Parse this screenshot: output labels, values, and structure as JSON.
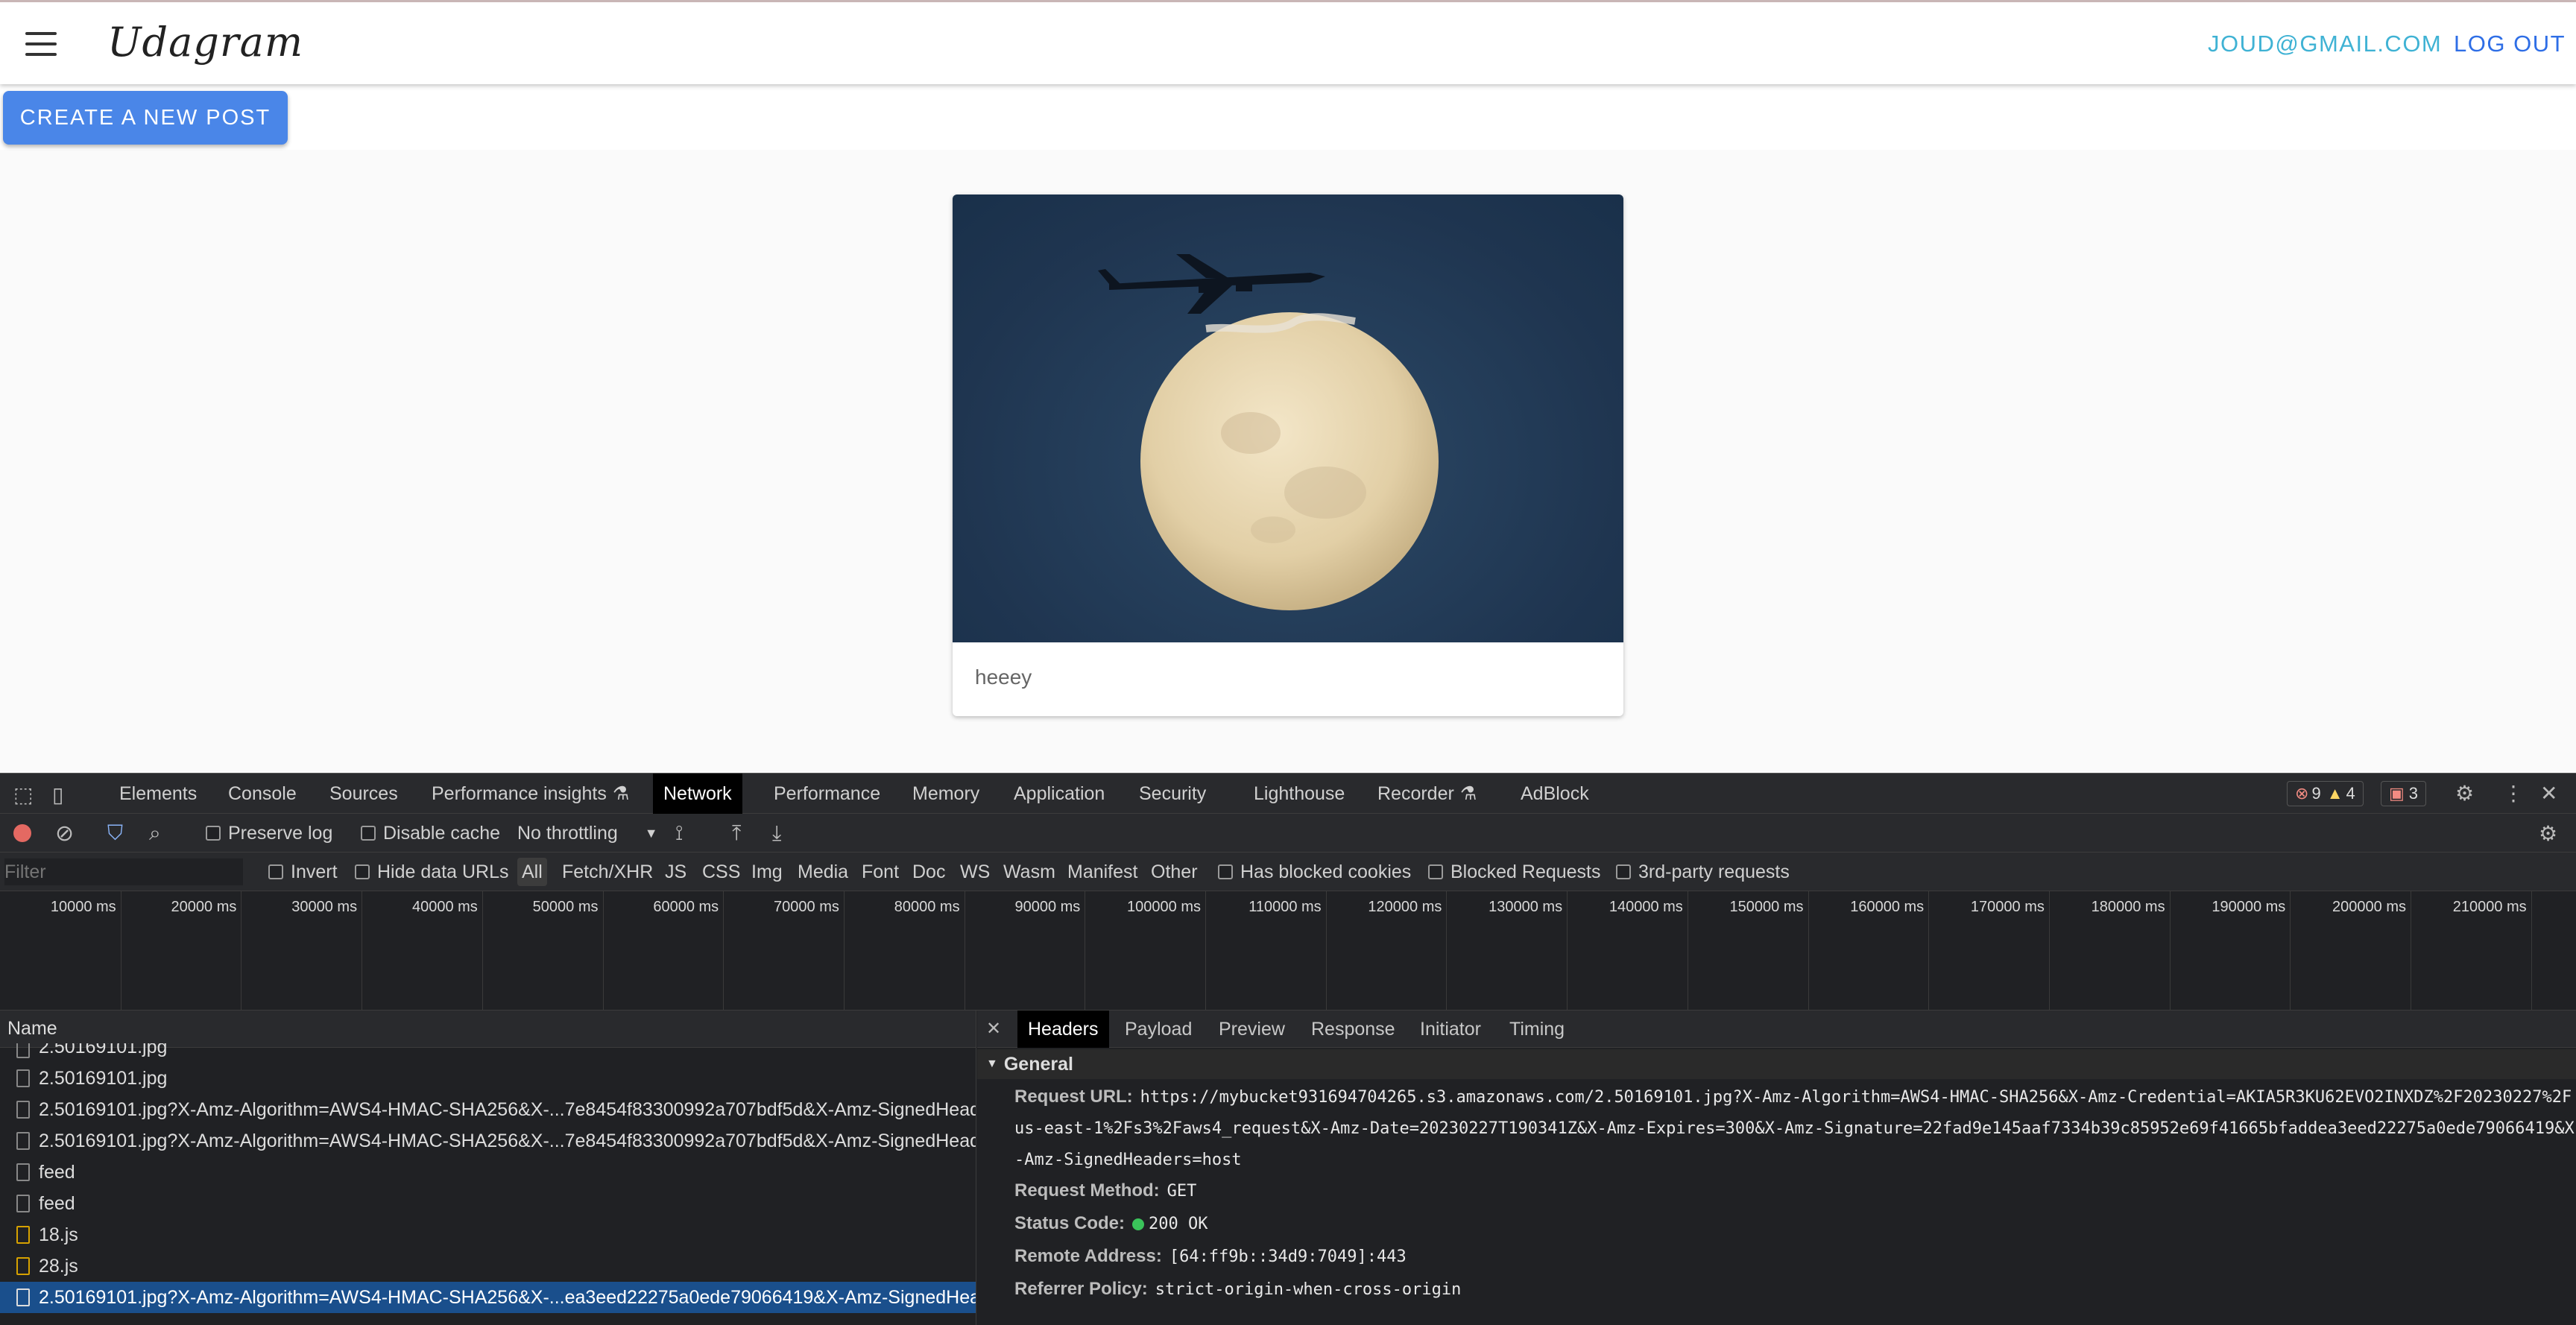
{
  "app": {
    "brand": "Udagram",
    "user_email": "JOUD@GMAIL.COM",
    "logout_label": "LOG OUT",
    "create_post_label": "CREATE A NEW POST",
    "post": {
      "caption": "heeey"
    }
  },
  "devtools": {
    "tabs": [
      "Elements",
      "Console",
      "Sources",
      "Performance insights",
      "Network",
      "Performance",
      "Memory",
      "Application",
      "Security",
      "Lighthouse",
      "Recorder",
      "AdBlock"
    ],
    "active_tab": "Network",
    "errors": "9",
    "warnings": "4",
    "issues": "3",
    "toolbar": {
      "preserve_log": "Preserve log",
      "disable_cache": "Disable cache",
      "throttling": "No throttling"
    },
    "filter": {
      "placeholder": "Filter",
      "invert": "Invert",
      "hide_data_urls": "Hide data URLs",
      "types": [
        "All",
        "Fetch/XHR",
        "JS",
        "CSS",
        "Img",
        "Media",
        "Font",
        "Doc",
        "WS",
        "Wasm",
        "Manifest",
        "Other"
      ],
      "has_blocked_cookies": "Has blocked cookies",
      "blocked_requests": "Blocked Requests",
      "third_party": "3rd-party requests"
    },
    "timeline_ticks": [
      "10000 ms",
      "20000 ms",
      "30000 ms",
      "40000 ms",
      "50000 ms",
      "60000 ms",
      "70000 ms",
      "80000 ms",
      "90000 ms",
      "100000 ms",
      "110000 ms",
      "120000 ms",
      "130000 ms",
      "140000 ms",
      "150000 ms",
      "160000 ms",
      "170000 ms",
      "180000 ms",
      "190000 ms",
      "200000 ms",
      "210000 ms"
    ],
    "requests": {
      "column": "Name",
      "rows": [
        "2.50169101.jpg",
        "2.50169101.jpg",
        "2.50169101.jpg?X-Amz-Algorithm=AWS4-HMAC-SHA256&X-...7e8454f83300992a707bdf5d&X-Amz-SignedHead...",
        "2.50169101.jpg?X-Amz-Algorithm=AWS4-HMAC-SHA256&X-...7e8454f83300992a707bdf5d&X-Amz-SignedHead...",
        "feed",
        "feed",
        "18.js",
        "28.js",
        "2.50169101.jpg?X-Amz-Algorithm=AWS4-HMAC-SHA256&X-...ea3eed22275a0ede79066419&X-Amz-SignedHea..."
      ]
    },
    "details": {
      "tabs": [
        "Headers",
        "Payload",
        "Preview",
        "Response",
        "Initiator",
        "Timing"
      ],
      "active": "Headers",
      "section": "General",
      "request_url_label": "Request URL:",
      "request_url_1": "https://mybucket931694704265.s3.amazonaws.com/2.50169101.jpg?X-Amz-Algorithm=AWS4-HMAC-SHA256&X-Amz-Credential=AKIA5R3KU62EVO2INXDZ%2F20230227%2F",
      "request_url_2": "us-east-1%2Fs3%2Faws4_request&X-Amz-Date=20230227T190341Z&X-Amz-Expires=300&X-Amz-Signature=22fad9e145aaf7334b39c85952e69f41665bfaddea3eed22275a0ede79066419&X",
      "request_url_3": "-Amz-SignedHeaders=host",
      "method_label": "Request Method:",
      "method": "GET",
      "status_label": "Status Code:",
      "status": "200 OK",
      "remote_label": "Remote Address:",
      "remote": "[64:ff9b::34d9:7049]:443",
      "referrer_label": "Referrer Policy:",
      "referrer": "strict-origin-when-cross-origin"
    }
  }
}
